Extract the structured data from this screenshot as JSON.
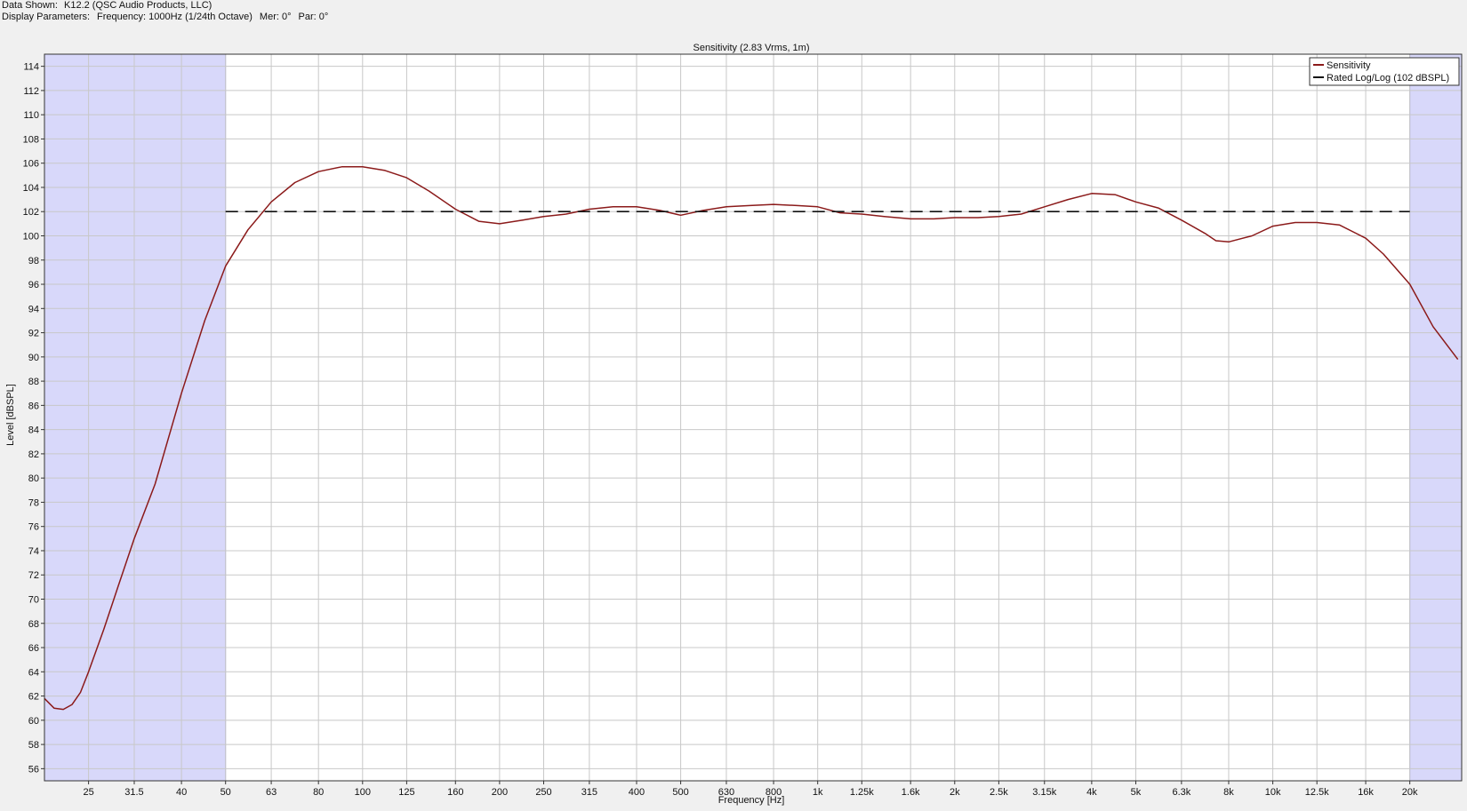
{
  "info": {
    "data_shown_label": "Data Shown:",
    "data_shown_value": "K12.2 (QSC Audio Products, LLC)",
    "display_params_label": "Display Parameters:",
    "frequency": "Frequency: 1000Hz (1/24th Octave)",
    "mer": "Mer: 0°",
    "par": "Par: 0°"
  },
  "chart_data": {
    "type": "line",
    "title": "Sensitivity (2.83 Vrms, 1m)",
    "xlabel": "Frequency [Hz]",
    "ylabel": "Level [dBSPL]",
    "x_scale": "log",
    "xlim": [
      20,
      26000
    ],
    "ylim": [
      55,
      115
    ],
    "grid": true,
    "legend_position": "top-right",
    "x_ticks": [
      {
        "value": 25,
        "label": "25"
      },
      {
        "value": 31.5,
        "label": "31.5"
      },
      {
        "value": 40,
        "label": "40"
      },
      {
        "value": 50,
        "label": "50"
      },
      {
        "value": 63,
        "label": "63"
      },
      {
        "value": 80,
        "label": "80"
      },
      {
        "value": 100,
        "label": "100"
      },
      {
        "value": 125,
        "label": "125"
      },
      {
        "value": 160,
        "label": "160"
      },
      {
        "value": 200,
        "label": "200"
      },
      {
        "value": 250,
        "label": "250"
      },
      {
        "value": 315,
        "label": "315"
      },
      {
        "value": 400,
        "label": "400"
      },
      {
        "value": 500,
        "label": "500"
      },
      {
        "value": 630,
        "label": "630"
      },
      {
        "value": 800,
        "label": "800"
      },
      {
        "value": 1000,
        "label": "1k"
      },
      {
        "value": 1250,
        "label": "1.25k"
      },
      {
        "value": 1600,
        "label": "1.6k"
      },
      {
        "value": 2000,
        "label": "2k"
      },
      {
        "value": 2500,
        "label": "2.5k"
      },
      {
        "value": 3150,
        "label": "3.15k"
      },
      {
        "value": 4000,
        "label": "4k"
      },
      {
        "value": 5000,
        "label": "5k"
      },
      {
        "value": 6300,
        "label": "6.3k"
      },
      {
        "value": 8000,
        "label": "8k"
      },
      {
        "value": 10000,
        "label": "10k"
      },
      {
        "value": 12500,
        "label": "12.5k"
      },
      {
        "value": 16000,
        "label": "16k"
      },
      {
        "value": 20000,
        "label": "20k"
      }
    ],
    "y_ticks": [
      56,
      58,
      60,
      62,
      64,
      66,
      68,
      70,
      72,
      74,
      76,
      78,
      80,
      82,
      84,
      86,
      88,
      90,
      92,
      94,
      96,
      98,
      100,
      102,
      104,
      106,
      108,
      110,
      112,
      114
    ],
    "shaded_ranges": [
      [
        20,
        50
      ],
      [
        20000,
        26000
      ]
    ],
    "series": [
      {
        "name": "Sensitivity",
        "color": "#8b1a1a",
        "style": "solid",
        "points": [
          [
            20,
            61.8
          ],
          [
            21,
            61.0
          ],
          [
            22,
            60.9
          ],
          [
            23,
            61.3
          ],
          [
            24,
            62.3
          ],
          [
            25,
            64.0
          ],
          [
            27,
            67.5
          ],
          [
            29,
            71.0
          ],
          [
            31.5,
            75.0
          ],
          [
            35,
            79.5
          ],
          [
            40,
            87.0
          ],
          [
            45,
            93.0
          ],
          [
            50,
            97.5
          ],
          [
            56,
            100.5
          ],
          [
            63,
            102.8
          ],
          [
            71,
            104.4
          ],
          [
            80,
            105.3
          ],
          [
            90,
            105.7
          ],
          [
            100,
            105.7
          ],
          [
            112,
            105.4
          ],
          [
            125,
            104.8
          ],
          [
            140,
            103.7
          ],
          [
            160,
            102.2
          ],
          [
            180,
            101.2
          ],
          [
            200,
            101.0
          ],
          [
            225,
            101.3
          ],
          [
            250,
            101.6
          ],
          [
            280,
            101.8
          ],
          [
            315,
            102.2
          ],
          [
            355,
            102.4
          ],
          [
            400,
            102.4
          ],
          [
            450,
            102.1
          ],
          [
            500,
            101.7
          ],
          [
            560,
            102.1
          ],
          [
            630,
            102.4
          ],
          [
            710,
            102.5
          ],
          [
            800,
            102.6
          ],
          [
            900,
            102.5
          ],
          [
            1000,
            102.4
          ],
          [
            1120,
            101.9
          ],
          [
            1250,
            101.8
          ],
          [
            1400,
            101.6
          ],
          [
            1600,
            101.4
          ],
          [
            1800,
            101.4
          ],
          [
            2000,
            101.5
          ],
          [
            2250,
            101.5
          ],
          [
            2500,
            101.6
          ],
          [
            2800,
            101.8
          ],
          [
            3150,
            102.4
          ],
          [
            3550,
            103.0
          ],
          [
            4000,
            103.5
          ],
          [
            4500,
            103.4
          ],
          [
            5000,
            102.8
          ],
          [
            5600,
            102.3
          ],
          [
            6300,
            101.3
          ],
          [
            7100,
            100.2
          ],
          [
            7500,
            99.6
          ],
          [
            8000,
            99.5
          ],
          [
            9000,
            100.0
          ],
          [
            10000,
            100.8
          ],
          [
            11200,
            101.1
          ],
          [
            12500,
            101.1
          ],
          [
            14000,
            100.9
          ],
          [
            16000,
            99.8
          ],
          [
            17500,
            98.5
          ],
          [
            20000,
            96.0
          ],
          [
            22500,
            92.5
          ],
          [
            25500,
            89.8
          ]
        ]
      },
      {
        "name": "Rated Log/Log (102 dBSPL)",
        "color": "#111111",
        "style": "dashed",
        "points": [
          [
            50,
            102
          ],
          [
            20000,
            102
          ]
        ]
      }
    ]
  }
}
